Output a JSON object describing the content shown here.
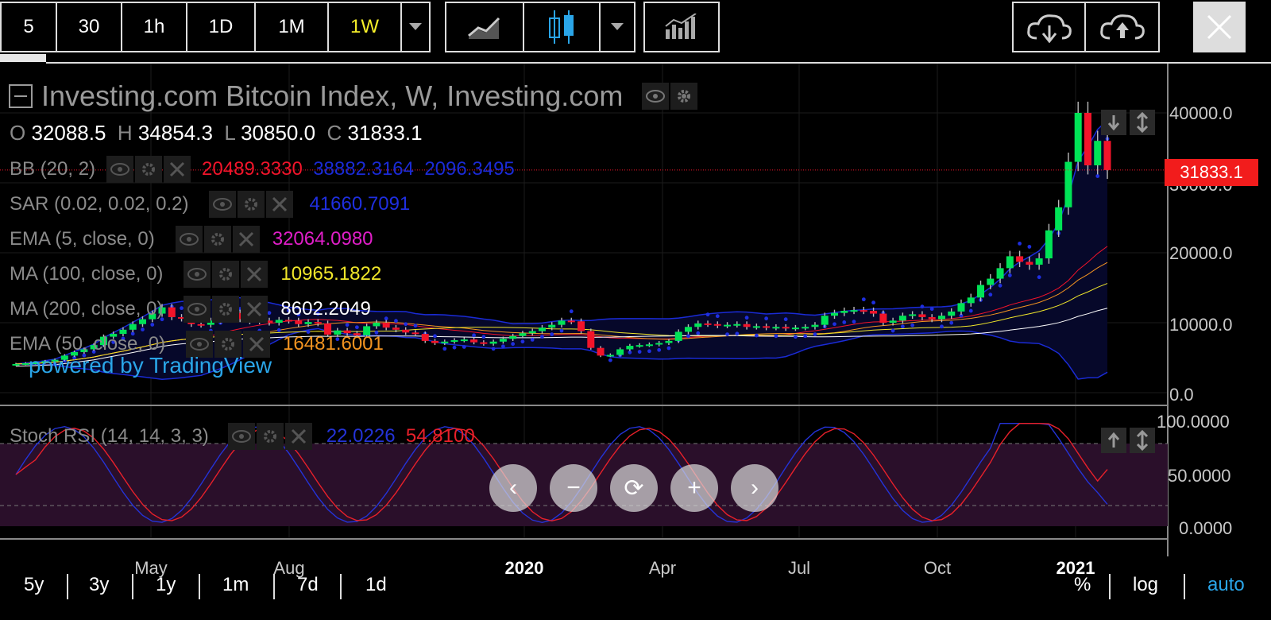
{
  "toolbar": {
    "intervals": [
      "5",
      "30",
      "1h",
      "1D",
      "1M",
      "1W"
    ],
    "active_interval": "1W"
  },
  "chart_title": "Investing.com Bitcoin Index, W, Investing.com",
  "ohlc": {
    "o_label": "O",
    "o": "32088.5",
    "h_label": "H",
    "h": "34854.3",
    "l_label": "L",
    "l": "30850.0",
    "c_label": "C",
    "c": "31833.1"
  },
  "indicators": {
    "bb": {
      "name": "BB (20, 2)",
      "v1": "20489.3330",
      "v2": "38882.3164",
      "v3": "2096.3495"
    },
    "sar": {
      "name": "SAR (0.02, 0.02, 0.2)",
      "v1": "41660.7091"
    },
    "ema5": {
      "name": "EMA (5, close, 0)",
      "v1": "32064.0980"
    },
    "ma100": {
      "name": "MA (100, close, 0)",
      "v1": "10965.1822"
    },
    "ma200": {
      "name": "MA (200, close, 0)",
      "v1": "8602.2049"
    },
    "ema50": {
      "name": "EMA (50, close, 0)",
      "v1": "16481.6001"
    },
    "stoch": {
      "name": "Stoch RSI (14, 14, 3, 3)",
      "v1": "22.0226",
      "v2": "54.8100"
    }
  },
  "powered_by": "powered by TradingView",
  "last_price": "31833.1",
  "price_axis": [
    "40000.0",
    "30000.0",
    "20000.0",
    "10000.0",
    "0.0"
  ],
  "stoch_axis": [
    "100.0000",
    "50.0000",
    "0.0000"
  ],
  "time_axis": [
    "May",
    "Aug",
    "2020",
    "Apr",
    "Jul",
    "Oct",
    "2021"
  ],
  "ranges": [
    "5y",
    "3y",
    "1y",
    "1m",
    "7d",
    "1d"
  ],
  "scale_options": [
    "%",
    "log",
    "auto"
  ],
  "colors": {
    "up": "#00e356",
    "down": "#f2142a",
    "bb_band": "#1a2bd6",
    "sar": "#1f2fe0",
    "ema5": "#e01ec8",
    "ma100": "#f0e62a",
    "ma200": "#ffffff",
    "ema50": "#f39420",
    "stoch_k": "#2433d8",
    "stoch_d": "#e8202a",
    "stoch_fill": "#2a0f2a",
    "accent": "#2aa5e8"
  },
  "chart_data": {
    "type": "candlestick",
    "title": "Investing.com Bitcoin Index, W, Investing.com",
    "ylim": [
      0,
      44000
    ],
    "x_ticks": [
      "May",
      "Aug",
      "2020",
      "Apr",
      "Jul",
      "Oct",
      "2021"
    ],
    "weekly_close": [
      4100,
      4200,
      4300,
      4500,
      4700,
      5300,
      5800,
      6200,
      6800,
      8000,
      8400,
      9000,
      9800,
      10500,
      11300,
      12200,
      10800,
      10600,
      9800,
      9700,
      10300,
      11600,
      11400,
      10500,
      10200,
      10300,
      10000,
      10400,
      10300,
      9800,
      10100,
      9900,
      8300,
      8900,
      8500,
      8200,
      9500,
      10000,
      9300,
      9000,
      8600,
      8400,
      7400,
      7100,
      7300,
      7500,
      7600,
      7200,
      7000,
      7300,
      7700,
      8100,
      8500,
      8800,
      9300,
      9700,
      10300,
      10200,
      8800,
      6400,
      5300,
      5400,
      6200,
      6700,
      6800,
      6900,
      7100,
      7400,
      8700,
      9400,
      9900,
      9800,
      9600,
      9700,
      9800,
      9400,
      9500,
      9300,
      9400,
      9200,
      9300,
      9400,
      9700,
      11000,
      11400,
      11700,
      11800,
      11700,
      11300,
      10000,
      10300,
      11000,
      11200,
      10800,
      10500,
      11000,
      11600,
      12800,
      13600,
      15400,
      16300,
      17800,
      19500,
      18700,
      18300,
      19200,
      23200,
      26500,
      33000,
      40000,
      32500,
      36000,
      31833
    ]
  }
}
